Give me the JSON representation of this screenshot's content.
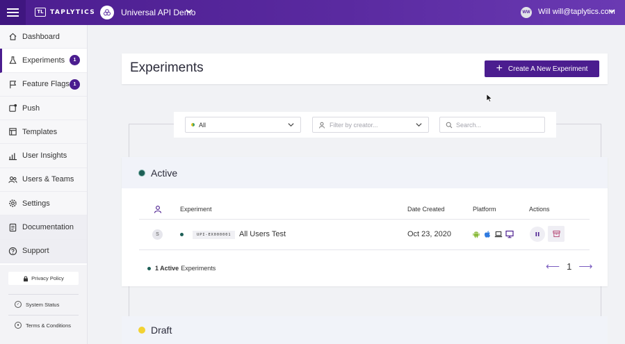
{
  "topbar": {
    "brand": "TAPLYTICS",
    "brand_mark": "TL",
    "project": "Universal API Demo",
    "user_initials": "WW",
    "user_label": "Will will@taplytics.com"
  },
  "sidebar": {
    "items": [
      {
        "label": "Dashboard",
        "icon": "home-icon"
      },
      {
        "label": "Experiments",
        "icon": "flask-icon",
        "badge": "1"
      },
      {
        "label": "Feature Flags",
        "icon": "flag-icon",
        "badge": "1"
      },
      {
        "label": "Push",
        "icon": "push-icon"
      },
      {
        "label": "Templates",
        "icon": "template-icon"
      },
      {
        "label": "User Insights",
        "icon": "chart-icon"
      },
      {
        "label": "Users & Teams",
        "icon": "users-icon"
      },
      {
        "label": "Settings",
        "icon": "gear-icon"
      },
      {
        "label": "Documentation",
        "icon": "doc-icon"
      },
      {
        "label": "Support",
        "icon": "help-icon"
      }
    ],
    "privacy": "Privacy Policy",
    "system_status": "System Status",
    "terms": "Terms & Conditions"
  },
  "main": {
    "title": "Experiments",
    "create_label": "Create A New Experiment",
    "filters": {
      "status_value": "All",
      "creator_placeholder": "Filter by creator...",
      "search_placeholder": "Search..."
    },
    "active_section": {
      "title": "Active",
      "columns": [
        "Experiment",
        "Date Created",
        "Platform",
        "Actions"
      ],
      "row": {
        "avatar": "S",
        "id": "UPI-EX000001",
        "name": "All Users Test",
        "date": "Oct 23, 2020",
        "platforms": [
          "android-icon",
          "apple-icon",
          "laptop-icon",
          "desktop-icon"
        ]
      },
      "count_bold": "1 Active",
      "count_rest": "Experiments",
      "page": "1"
    },
    "draft_section": {
      "title": "Draft"
    }
  },
  "colors": {
    "brand_purple": "#4b1d8f",
    "active_green": "#1d5f56",
    "draft_yellow": "#f2d233"
  }
}
